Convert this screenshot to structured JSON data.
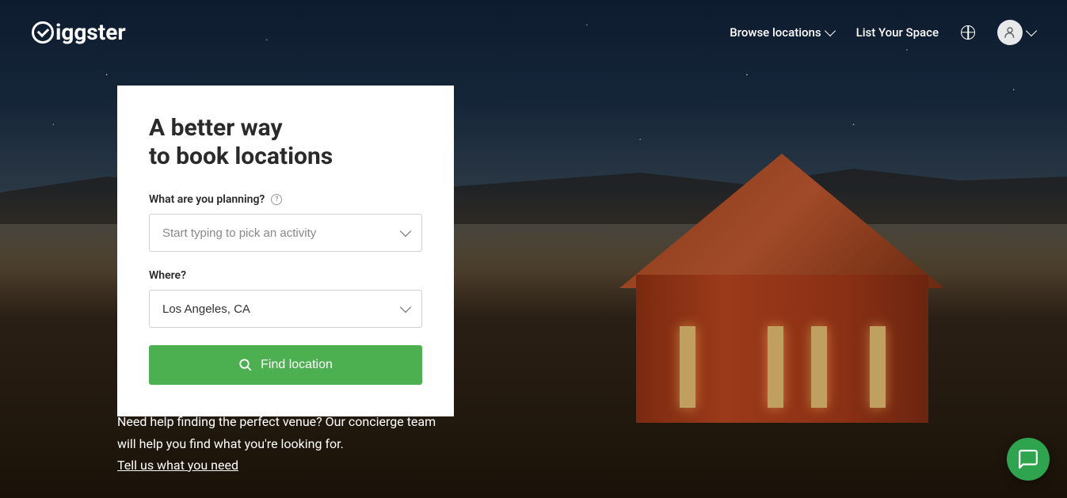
{
  "header": {
    "logo_text": "iggster",
    "nav": {
      "browse": "Browse locations",
      "list_space": "List Your Space"
    }
  },
  "search": {
    "title_line1": "A better way",
    "title_line2": "to book locations",
    "planning_label": "What are you planning?",
    "planning_placeholder": "Start typing to pick an activity",
    "where_label": "Where?",
    "where_value": "Los Angeles, CA",
    "find_button": "Find location"
  },
  "concierge": {
    "line1": "Need help finding the perfect venue? Our concierge team",
    "line2": "will help you find what you're looking for.",
    "link": "Tell us what you need"
  }
}
